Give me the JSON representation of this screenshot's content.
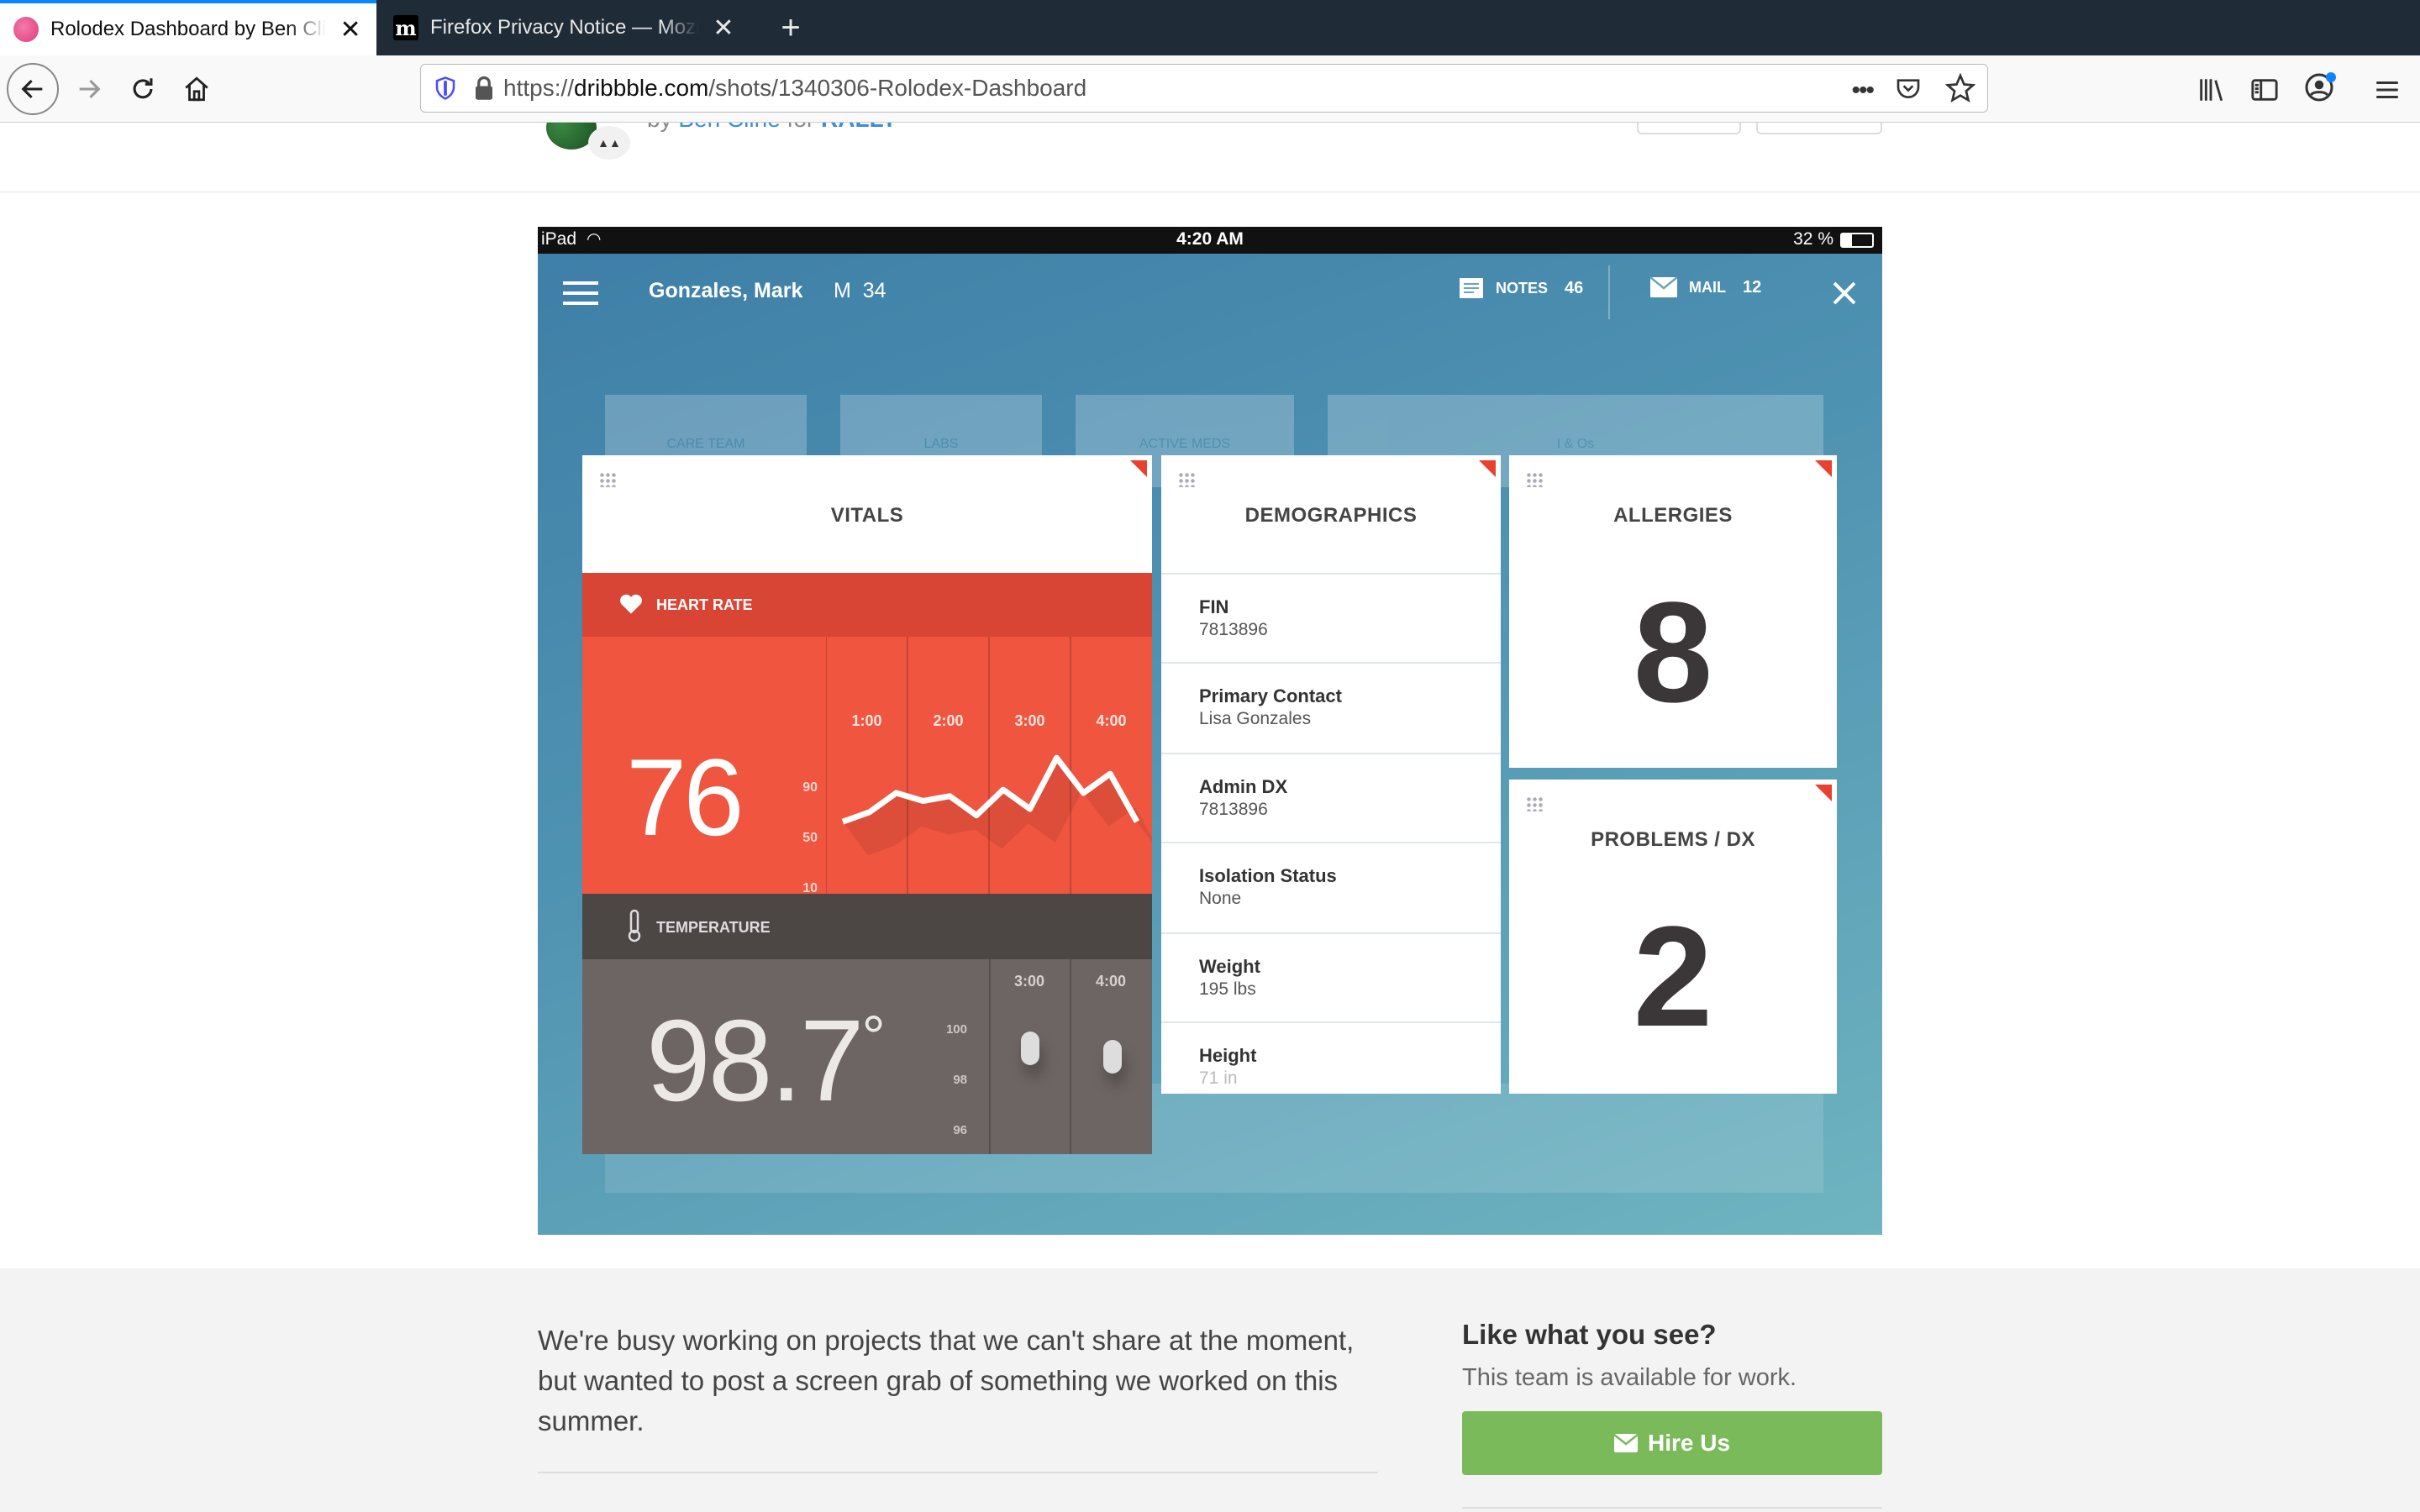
{
  "tabs": [
    {
      "title": "Rolodex Dashboard by Ben Cline for RALLY",
      "active": true,
      "favicon": "dribbble-icon"
    },
    {
      "title": "Firefox Privacy Notice — Mozilla",
      "active": false,
      "favicon": "mozilla-icon"
    }
  ],
  "nav": {
    "url_prefix": "https://",
    "url_host": "dribbble.com",
    "url_path": "/shots/1340306-Rolodex-Dashboard"
  },
  "shot_header": {
    "byline_prefix": "by",
    "author": "Ben Cline",
    "for_word": "for",
    "team": "RALLY"
  },
  "ipad": {
    "status_left": "iPad",
    "time": "4:20 AM",
    "battery": "32 %",
    "patient_name": "Gonzales, Mark",
    "patient_info": "M  34",
    "notes_label": "NOTES",
    "notes_count": "46",
    "mail_label": "MAIL",
    "mail_count": "12",
    "bg_tabs": [
      "CARE TEAM",
      "LABS",
      "ACTIVE MEDS",
      "I & Os"
    ],
    "vitals": {
      "title": "VITALS",
      "heart_rate_label": "HEART RATE",
      "heart_rate_value": "76",
      "hr_scale": [
        "90",
        "50",
        "10"
      ],
      "hr_times": [
        "1:00",
        "2:00",
        "3:00",
        "4:00"
      ],
      "hr_series": [
        42,
        48,
        60,
        55,
        58,
        46,
        62,
        50,
        82,
        60,
        72,
        42
      ],
      "temperature_label": "TEMPERATURE",
      "temperature_value": "98.7",
      "temp_unit": "°",
      "temp_scale": [
        "100",
        "98",
        "96"
      ],
      "temp_times": [
        "3:00",
        "4:00"
      ]
    },
    "demographics": {
      "title": "DEMOGRAPHICS",
      "items": [
        {
          "label": "FIN",
          "value": "7813896"
        },
        {
          "label": "Primary Contact",
          "value": "Lisa Gonzales"
        },
        {
          "label": "Admin DX",
          "value": "7813896"
        },
        {
          "label": "Isolation Status",
          "value": "None"
        },
        {
          "label": "Weight",
          "value": "195 lbs"
        },
        {
          "label": "Height",
          "value": "71 in"
        }
      ]
    },
    "allergies": {
      "title": "ALLERGIES",
      "count": "8"
    },
    "problems": {
      "title": "PROBLEMS / DX",
      "count": "2"
    }
  },
  "description": "We're busy working on projects that we can't share at the moment, but wanted to post a screen grab of something we worked on this summer.",
  "sidebar": {
    "heading": "Like what you see?",
    "subtext": "This team is available for work.",
    "hire_button": "Hire Us"
  },
  "colors": {
    "accent_red": "#e8412f",
    "heart_panel": "#f0553f",
    "temp_panel": "#6d6563",
    "hire_green": "#7bba5b",
    "link_blue": "#3a8dde"
  }
}
